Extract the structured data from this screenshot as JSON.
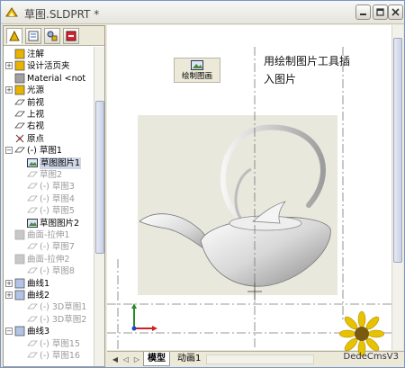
{
  "window": {
    "title": "草图.SLDPRT *",
    "buttons": [
      "minimize",
      "maximize",
      "close"
    ]
  },
  "left_panel": {
    "tabs": [
      "feature-manager-icon",
      "property-manager-icon",
      "configuration-manager-icon",
      "dim-xpert-icon"
    ],
    "tree": [
      {
        "label": "注解",
        "icon": "annotation-icon",
        "expander": "",
        "dim": false
      },
      {
        "label": "设计活页夹",
        "icon": "design-binder-icon",
        "expander": "+",
        "dim": false
      },
      {
        "label": "Material <not",
        "icon": "material-icon",
        "expander": "",
        "dim": false
      },
      {
        "label": "光源",
        "icon": "lights-icon",
        "expander": "+",
        "dim": false
      },
      {
        "label": "前视",
        "icon": "plane-icon",
        "expander": "",
        "dim": false
      },
      {
        "label": "上视",
        "icon": "plane-icon",
        "expander": "",
        "dim": false
      },
      {
        "label": "右视",
        "icon": "plane-icon",
        "expander": "",
        "dim": false
      },
      {
        "label": "原点",
        "icon": "origin-icon",
        "expander": "",
        "dim": false
      },
      {
        "label": "(-) 草图1",
        "icon": "sketch-icon",
        "expander": "-",
        "dim": false
      },
      {
        "label": "草图图片1",
        "icon": "sketch-picture-icon",
        "expander": "",
        "dim": false,
        "selected": true
      },
      {
        "label": "草图2",
        "icon": "sketch-icon",
        "expander": "",
        "dim": true
      },
      {
        "label": "(-) 草图3",
        "icon": "sketch-icon",
        "expander": "",
        "dim": true
      },
      {
        "label": "(-) 草图4",
        "icon": "sketch-icon",
        "expander": "",
        "dim": true
      },
      {
        "label": "(-) 草图5",
        "icon": "sketch-icon",
        "expander": "",
        "dim": true
      },
      {
        "label": "草图图片2",
        "icon": "sketch-picture-icon",
        "expander": "",
        "dim": false
      },
      {
        "label": "曲面-拉伸1",
        "icon": "surface-extrude-icon",
        "expander": "",
        "dim": true
      },
      {
        "label": "(-) 草图7",
        "icon": "sketch-icon",
        "expander": "",
        "dim": true
      },
      {
        "label": "曲面-拉伸2",
        "icon": "surface-extrude-icon",
        "expander": "",
        "dim": true
      },
      {
        "label": "(-) 草图8",
        "icon": "sketch-icon",
        "expander": "",
        "dim": true
      },
      {
        "label": "曲线1",
        "icon": "curve-icon",
        "expander": "+",
        "dim": false
      },
      {
        "label": "曲线2",
        "icon": "curve-icon",
        "expander": "+",
        "dim": false
      },
      {
        "label": "(-) 3D草图1",
        "icon": "sketch3d-icon",
        "expander": "",
        "dim": true
      },
      {
        "label": "(-) 3D草图2",
        "icon": "sketch3d-icon",
        "expander": "",
        "dim": true
      },
      {
        "label": "曲线3",
        "icon": "curve-icon",
        "expander": "-",
        "dim": false
      },
      {
        "label": "(-) 草图15",
        "icon": "sketch-icon",
        "expander": "",
        "dim": true
      },
      {
        "label": "(-) 草图16",
        "icon": "sketch-icon",
        "expander": "",
        "dim": true
      }
    ]
  },
  "viewport": {
    "sketch_picture_button": "绘制图画",
    "note_line1": "用绘制图片工具插",
    "note_line2": "入图片",
    "triad_icon": "coordinate-triad-icon"
  },
  "bottom_tabs": {
    "model": "模型",
    "animation": "动画1"
  },
  "watermark": {
    "text": "DedeCmsV3",
    "icon": "sunflower-icon"
  },
  "colors": {
    "picture_bg": "#e8e8dd",
    "accent_blue": "#316ac5",
    "selection": "#cfd6e8"
  }
}
